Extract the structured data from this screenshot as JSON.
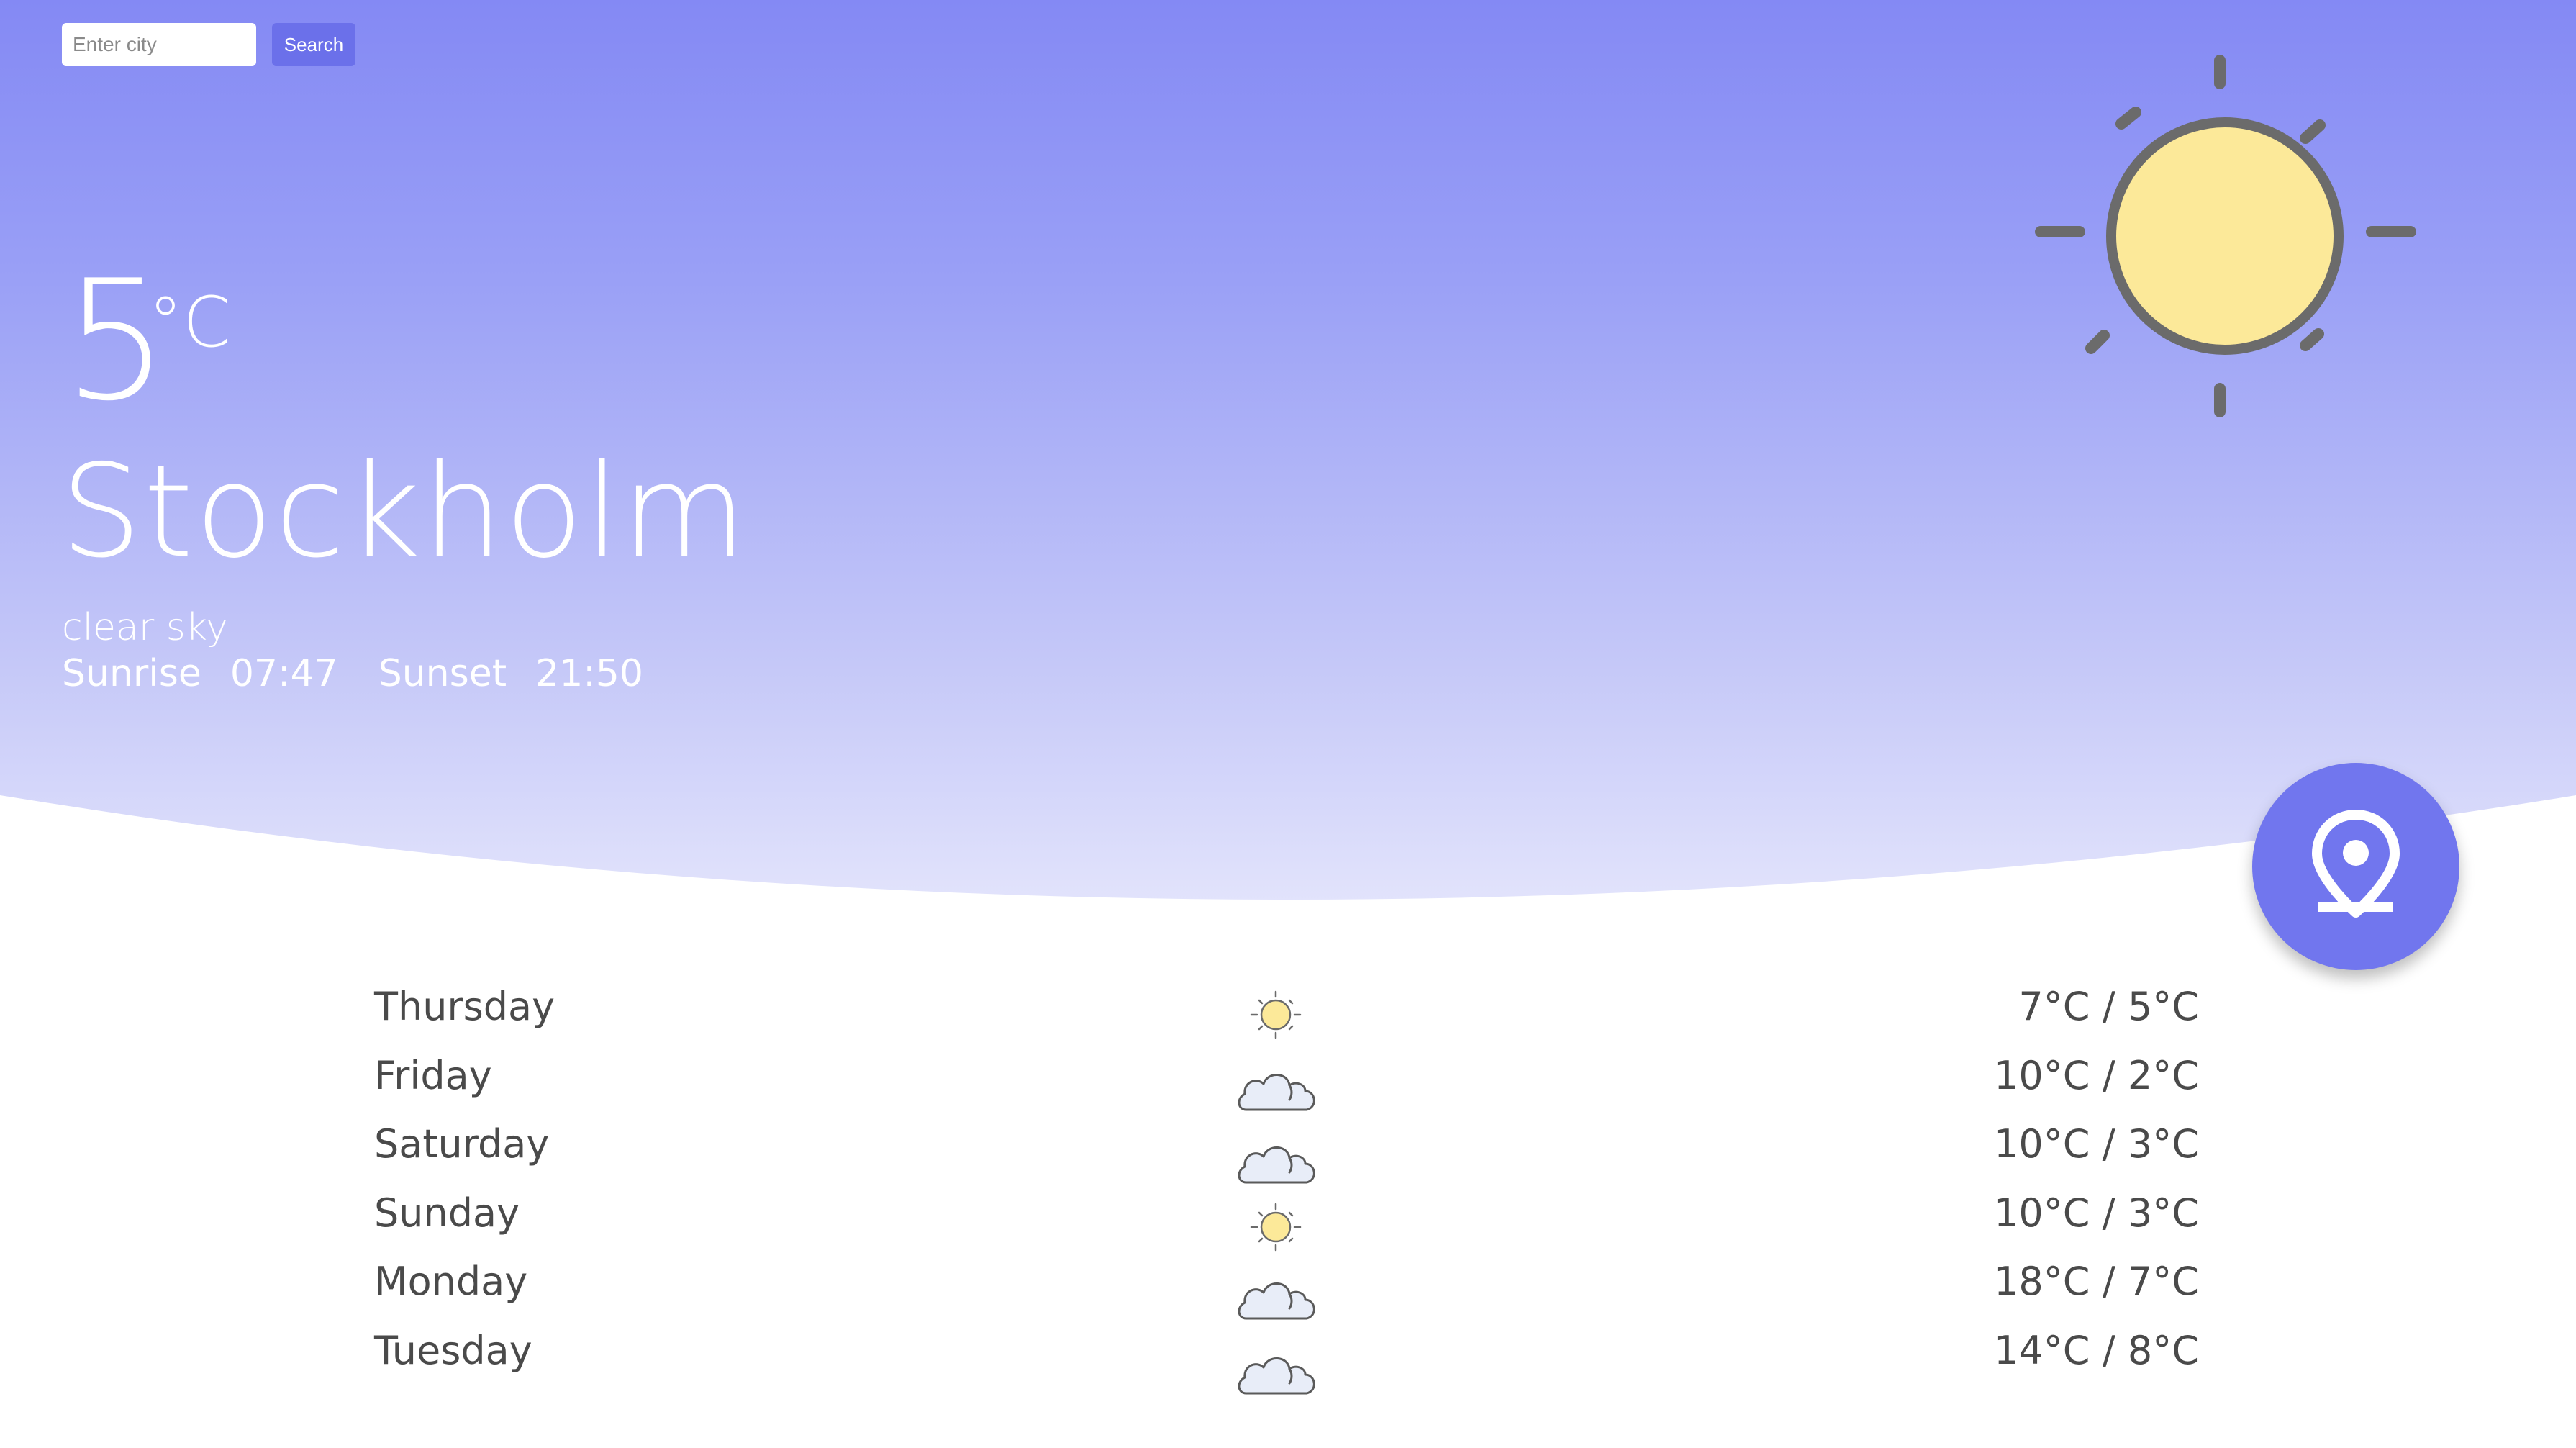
{
  "search": {
    "placeholder": "Enter city",
    "value": "",
    "button_label": "Search"
  },
  "current": {
    "temperature": "5",
    "unit": "°C",
    "city": "Stockholm",
    "description": "clear sky",
    "sunrise_label": "Sunrise",
    "sunrise_time": "07:47",
    "sunset_label": "Sunset",
    "sunset_time": "21:50",
    "icon": "sun-icon"
  },
  "location_button": {
    "icon": "map-pin-icon"
  },
  "forecast": [
    {
      "day": "Thursday",
      "icon": "sun-icon",
      "temps": "7°C / 5°C"
    },
    {
      "day": "Friday",
      "icon": "cloud-icon",
      "temps": "10°C / 2°C"
    },
    {
      "day": "Saturday",
      "icon": "cloud-icon",
      "temps": "10°C / 3°C"
    },
    {
      "day": "Sunday",
      "icon": "sun-icon",
      "temps": "10°C / 3°C"
    },
    {
      "day": "Monday",
      "icon": "cloud-icon",
      "temps": "18°C / 7°C"
    },
    {
      "day": "Tuesday",
      "icon": "cloud-icon",
      "temps": "14°C / 8°C"
    }
  ],
  "colors": {
    "accent": "#7176ee",
    "gradient_top": "#8489f4",
    "gradient_bottom": "#e6e7fc",
    "sun_fill": "#fce999",
    "sun_stroke": "#6b6b6b",
    "cloud_fill": "#e8edf8",
    "text_dark": "#4a4a4a"
  }
}
